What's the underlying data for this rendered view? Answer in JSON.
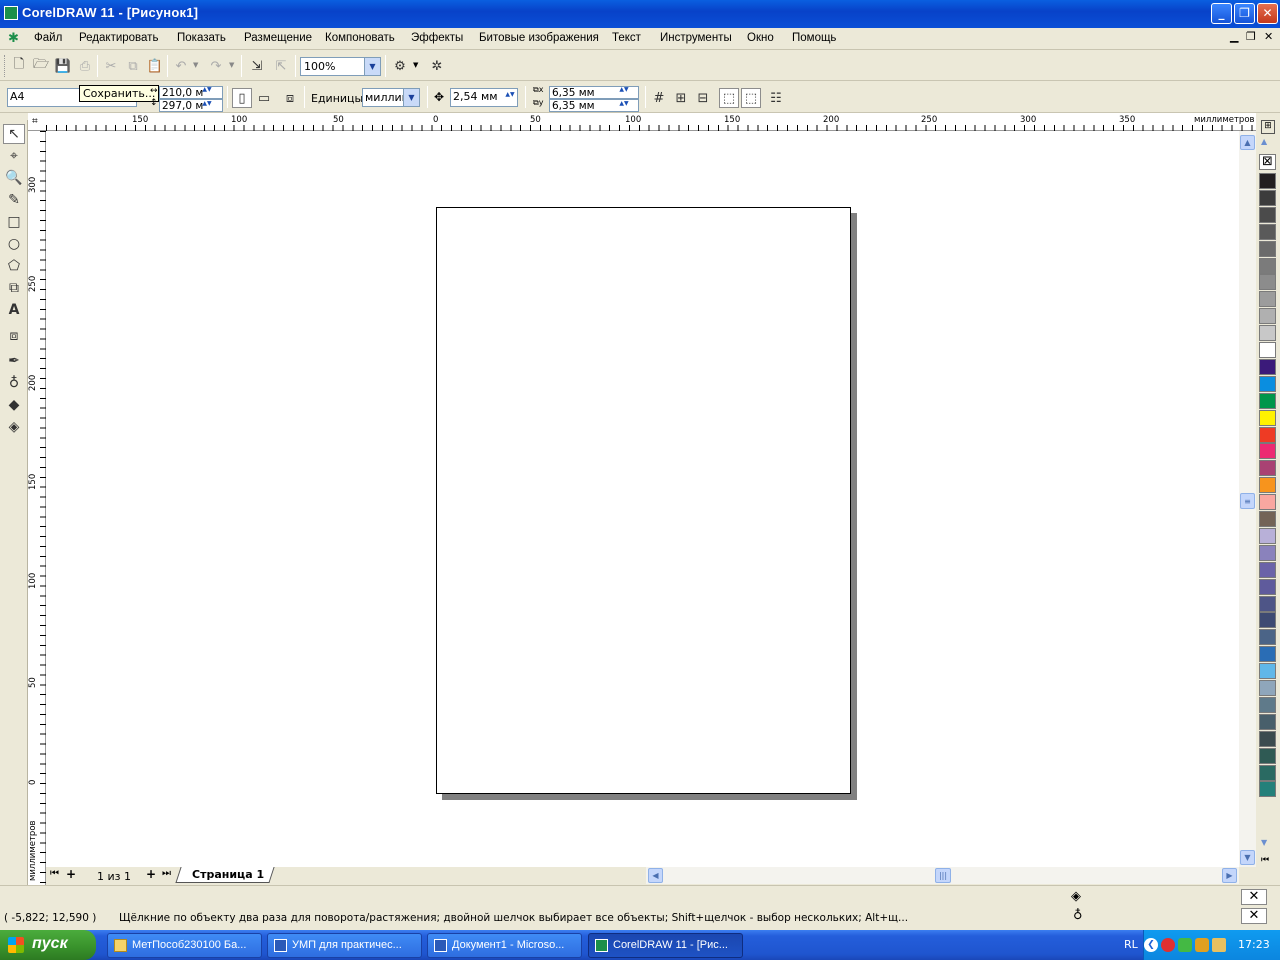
{
  "window": {
    "title": "CorelDRAW 11 - [Рисунок1]",
    "minimize_icon": "minimize-icon",
    "maximize_icon": "restore-icon",
    "close_icon": "close-icon"
  },
  "menubar": {
    "items": [
      "Файл",
      "Редактировать",
      "Показать",
      "Размещение",
      "Компоновать",
      "Эффекты",
      "Битовые изображения",
      "Текст",
      "Инструменты",
      "Окно",
      "Помощь"
    ]
  },
  "standard_toolbar": {
    "zoom_value": "100%"
  },
  "property_bar": {
    "paper_size": "A4",
    "tooltip": "Сохранить...",
    "width": "210,0 м",
    "height": "297,0 м",
    "units_label": "Единицы:",
    "units_value": "миллим",
    "nudge": "2,54 мм",
    "dup_x": "6,35 мм",
    "dup_y": "6,35 мм"
  },
  "rulers": {
    "unit_label": "миллиметров",
    "h_ticks": [
      "150",
      "100",
      "50",
      "0",
      "50",
      "100",
      "150",
      "200",
      "250",
      "300",
      "350"
    ],
    "v_ticks": [
      "300",
      "250",
      "200",
      "150",
      "100",
      "50",
      "0"
    ]
  },
  "page_tabs": {
    "counter": "1 из 1",
    "tab_label": "Страница 1"
  },
  "status": {
    "coords": "( -5,822; 12,590 )",
    "hint": "Щёлкние по объекту два раза для поворота/растяжения; двойной шелчок выбирает все объекты; Shift+щелчок - выбор нескольких; Alt+щ..."
  },
  "palette": {
    "colors": [
      "#231f20",
      "#3c3c3c",
      "#4b4b4b",
      "#5a5a5a",
      "#6b6b6b",
      "#7b7b7b",
      "#8c8c8c",
      "#9c9c9c",
      "#b0b0b0",
      "#c8c8c8",
      "#ffffff",
      "#3b1a7a",
      "#0a8ee0",
      "#00964a",
      "#fff200",
      "#ee3b24",
      "#ed2a72",
      "#a94273",
      "#f7941d",
      "#f9a7a0",
      "#736357",
      "#b8b0d8",
      "#8a82bc",
      "#6a63a8",
      "#5f5b9c",
      "#4e5587",
      "#3e4a72",
      "#4b6487",
      "#2a6db5",
      "#60b7e8",
      "#8fa6bb",
      "#5f7a8a",
      "#485f6b",
      "#3b4b4f",
      "#2f5a54",
      "#2a6a62",
      "#24807a"
    ]
  },
  "taskbar": {
    "start_label": "пуск",
    "tasks": [
      "МетПособ230100 Ба...",
      "УМП для практичес...",
      "Документ1 - Microso...",
      "CorelDRAW 11 - [Рис..."
    ],
    "lang": "RL",
    "clock": "17:23"
  }
}
